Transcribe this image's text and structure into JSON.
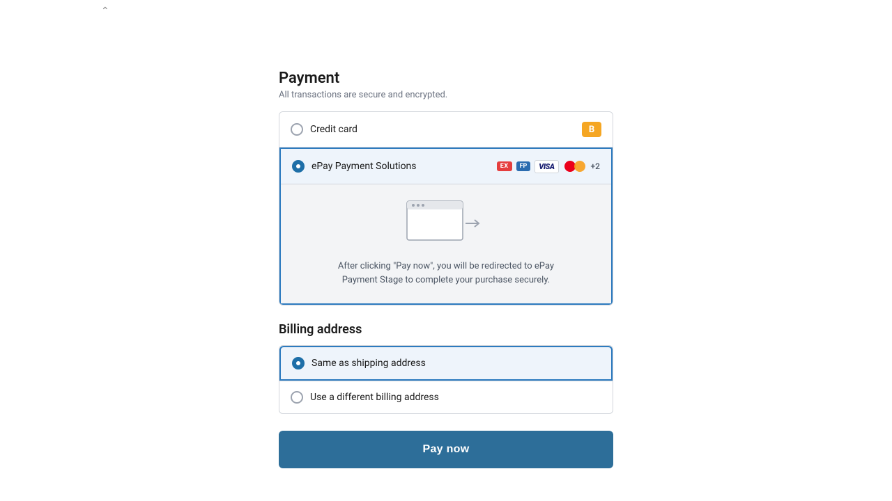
{
  "page": {
    "chevron_up": "^"
  },
  "payment": {
    "title": "Payment",
    "subtitle": "All transactions are secure and encrypted.",
    "options": [
      {
        "id": "credit-card",
        "label": "Credit card",
        "selected": false,
        "badge": "B",
        "icons": []
      },
      {
        "id": "epay",
        "label": "ePay Payment Solutions",
        "selected": true,
        "icons": [
          "epay-red",
          "epay-blue",
          "visa",
          "mastercard",
          "+2"
        ]
      }
    ],
    "redirect_text_line1": "After clicking \"Pay now\", you will be redirected to ePay",
    "redirect_text_line2": "Payment Stage to complete your purchase securely."
  },
  "billing": {
    "title": "Billing address",
    "options": [
      {
        "id": "same-as-shipping",
        "label": "Same as shipping address",
        "selected": true
      },
      {
        "id": "different-billing",
        "label": "Use a different billing address",
        "selected": false
      }
    ]
  },
  "pay_button": {
    "label": "Pay now"
  }
}
